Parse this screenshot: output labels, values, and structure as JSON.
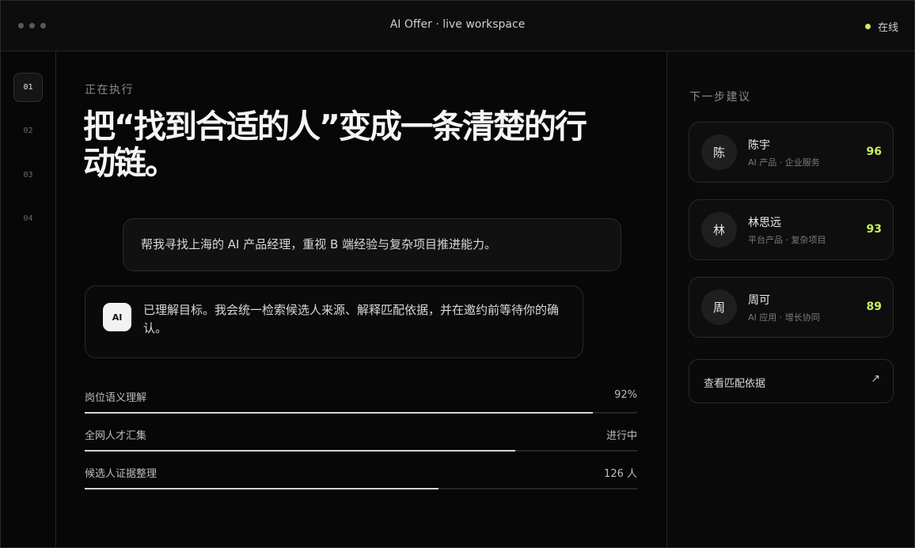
{
  "header": {
    "title": "AI Offer · live workspace",
    "status": "在线",
    "status_color": "#c6f05f"
  },
  "steps": [
    "01",
    "02",
    "03",
    "04"
  ],
  "active_step": "01",
  "main": {
    "eyebrow": "正在执行",
    "headline": "把“找到合适的人”变成一条清楚的行动链。",
    "user_message": "帮我寻找上海的 AI 产品经理，重视 B 端经验与复杂项目推进能力。",
    "ai_badge": "AI",
    "ai_message": "已理解目标。我会统一检索候选人来源、解释匹配依据，并在邀约前等待你的确认。",
    "progress": [
      {
        "label": "岗位语义理解",
        "value": "92%",
        "fill": 0.92
      },
      {
        "label": "全网人才汇集",
        "value": "进行中",
        "fill": 0.78
      },
      {
        "label": "候选人证据整理",
        "value": "126 人",
        "fill": 0.64
      }
    ]
  },
  "side": {
    "title": "下一步建议",
    "candidates": [
      {
        "avatar": "陈",
        "name": "陈宇",
        "tags": "AI 产品 · 企业服务",
        "score": "96"
      },
      {
        "avatar": "林",
        "name": "林思远",
        "tags": "平台产品 · 复杂项目",
        "score": "93"
      },
      {
        "avatar": "周",
        "name": "周可",
        "tags": "AI 应用 · 增长协同",
        "score": "89"
      }
    ],
    "evidence_button": "查看匹配依据",
    "evidence_icon": "↗"
  }
}
